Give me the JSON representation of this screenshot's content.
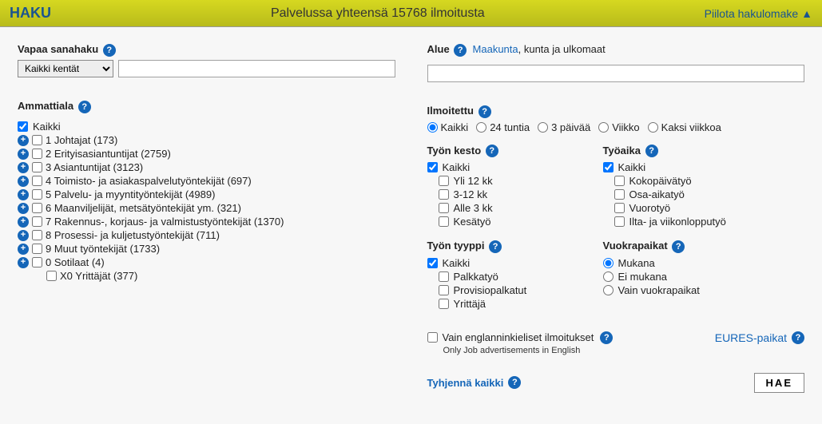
{
  "banner": {
    "title": "HAKU",
    "center": "Palvelussa yhteensä 15768 ilmoitusta",
    "hide": "Piilota hakulomake"
  },
  "left": {
    "freeSearchLabel": "Vapaa sanahaku",
    "fieldSelect": "Kaikki kentät",
    "ammattiLabel": "Ammattiala",
    "ammattiAll": "Kaikki",
    "items": [
      {
        "label": "1 Johtajat (173)",
        "expandable": true
      },
      {
        "label": "2 Erityisasiantuntijat (2759)",
        "expandable": true
      },
      {
        "label": "3 Asiantuntijat (3123)",
        "expandable": true
      },
      {
        "label": "4 Toimisto- ja asiakaspalvelutyöntekijät (697)",
        "expandable": true
      },
      {
        "label": "5 Palvelu- ja myyntityöntekijät (4989)",
        "expandable": true
      },
      {
        "label": "6 Maanviljelijät, metsätyöntekijät ym. (321)",
        "expandable": true
      },
      {
        "label": "7 Rakennus-, korjaus- ja valmistustyöntekijät (1370)",
        "expandable": true
      },
      {
        "label": "8 Prosessi- ja kuljetustyöntekijät (711)",
        "expandable": true
      },
      {
        "label": "9 Muut työntekijät (1733)",
        "expandable": true
      },
      {
        "label": "0 Sotilaat (4)",
        "expandable": true
      },
      {
        "label": "X0 Yrittäjät (377)",
        "expandable": false
      }
    ]
  },
  "right": {
    "alueLabel": "Alue",
    "alueLink": "Maakunta",
    "alueRest": ", kunta ja ulkomaat",
    "ilmoitettu": {
      "label": "Ilmoitettu",
      "opts": [
        "Kaikki",
        "24 tuntia",
        "3 päivää",
        "Viikko",
        "Kaksi viikkoa"
      ]
    },
    "kesto": {
      "label": "Työn kesto",
      "all": "Kaikki",
      "opts": [
        "Yli 12 kk",
        "3-12 kk",
        "Alle 3 kk",
        "Kesätyö"
      ]
    },
    "tyoaika": {
      "label": "Työaika",
      "all": "Kaikki",
      "opts": [
        "Kokopäivätyö",
        "Osa-aikatyö",
        "Vuorotyö",
        "Ilta- ja viikonlopputyö"
      ]
    },
    "tyyppi": {
      "label": "Työn tyyppi",
      "all": "Kaikki",
      "opts": [
        "Palkkatyö",
        "Provisiopalkatut",
        "Yrittäjä"
      ]
    },
    "vuokra": {
      "label": "Vuokrapaikat",
      "opts": [
        "Mukana",
        "Ei mukana",
        "Vain vuokrapaikat"
      ]
    },
    "english": {
      "label": "Vain englanninkieliset ilmoitukset",
      "sub": "Only Job advertisements in English"
    },
    "eures": "EURES-paikat",
    "clear": "Tyhjennä kaikki",
    "search": "HAE"
  }
}
